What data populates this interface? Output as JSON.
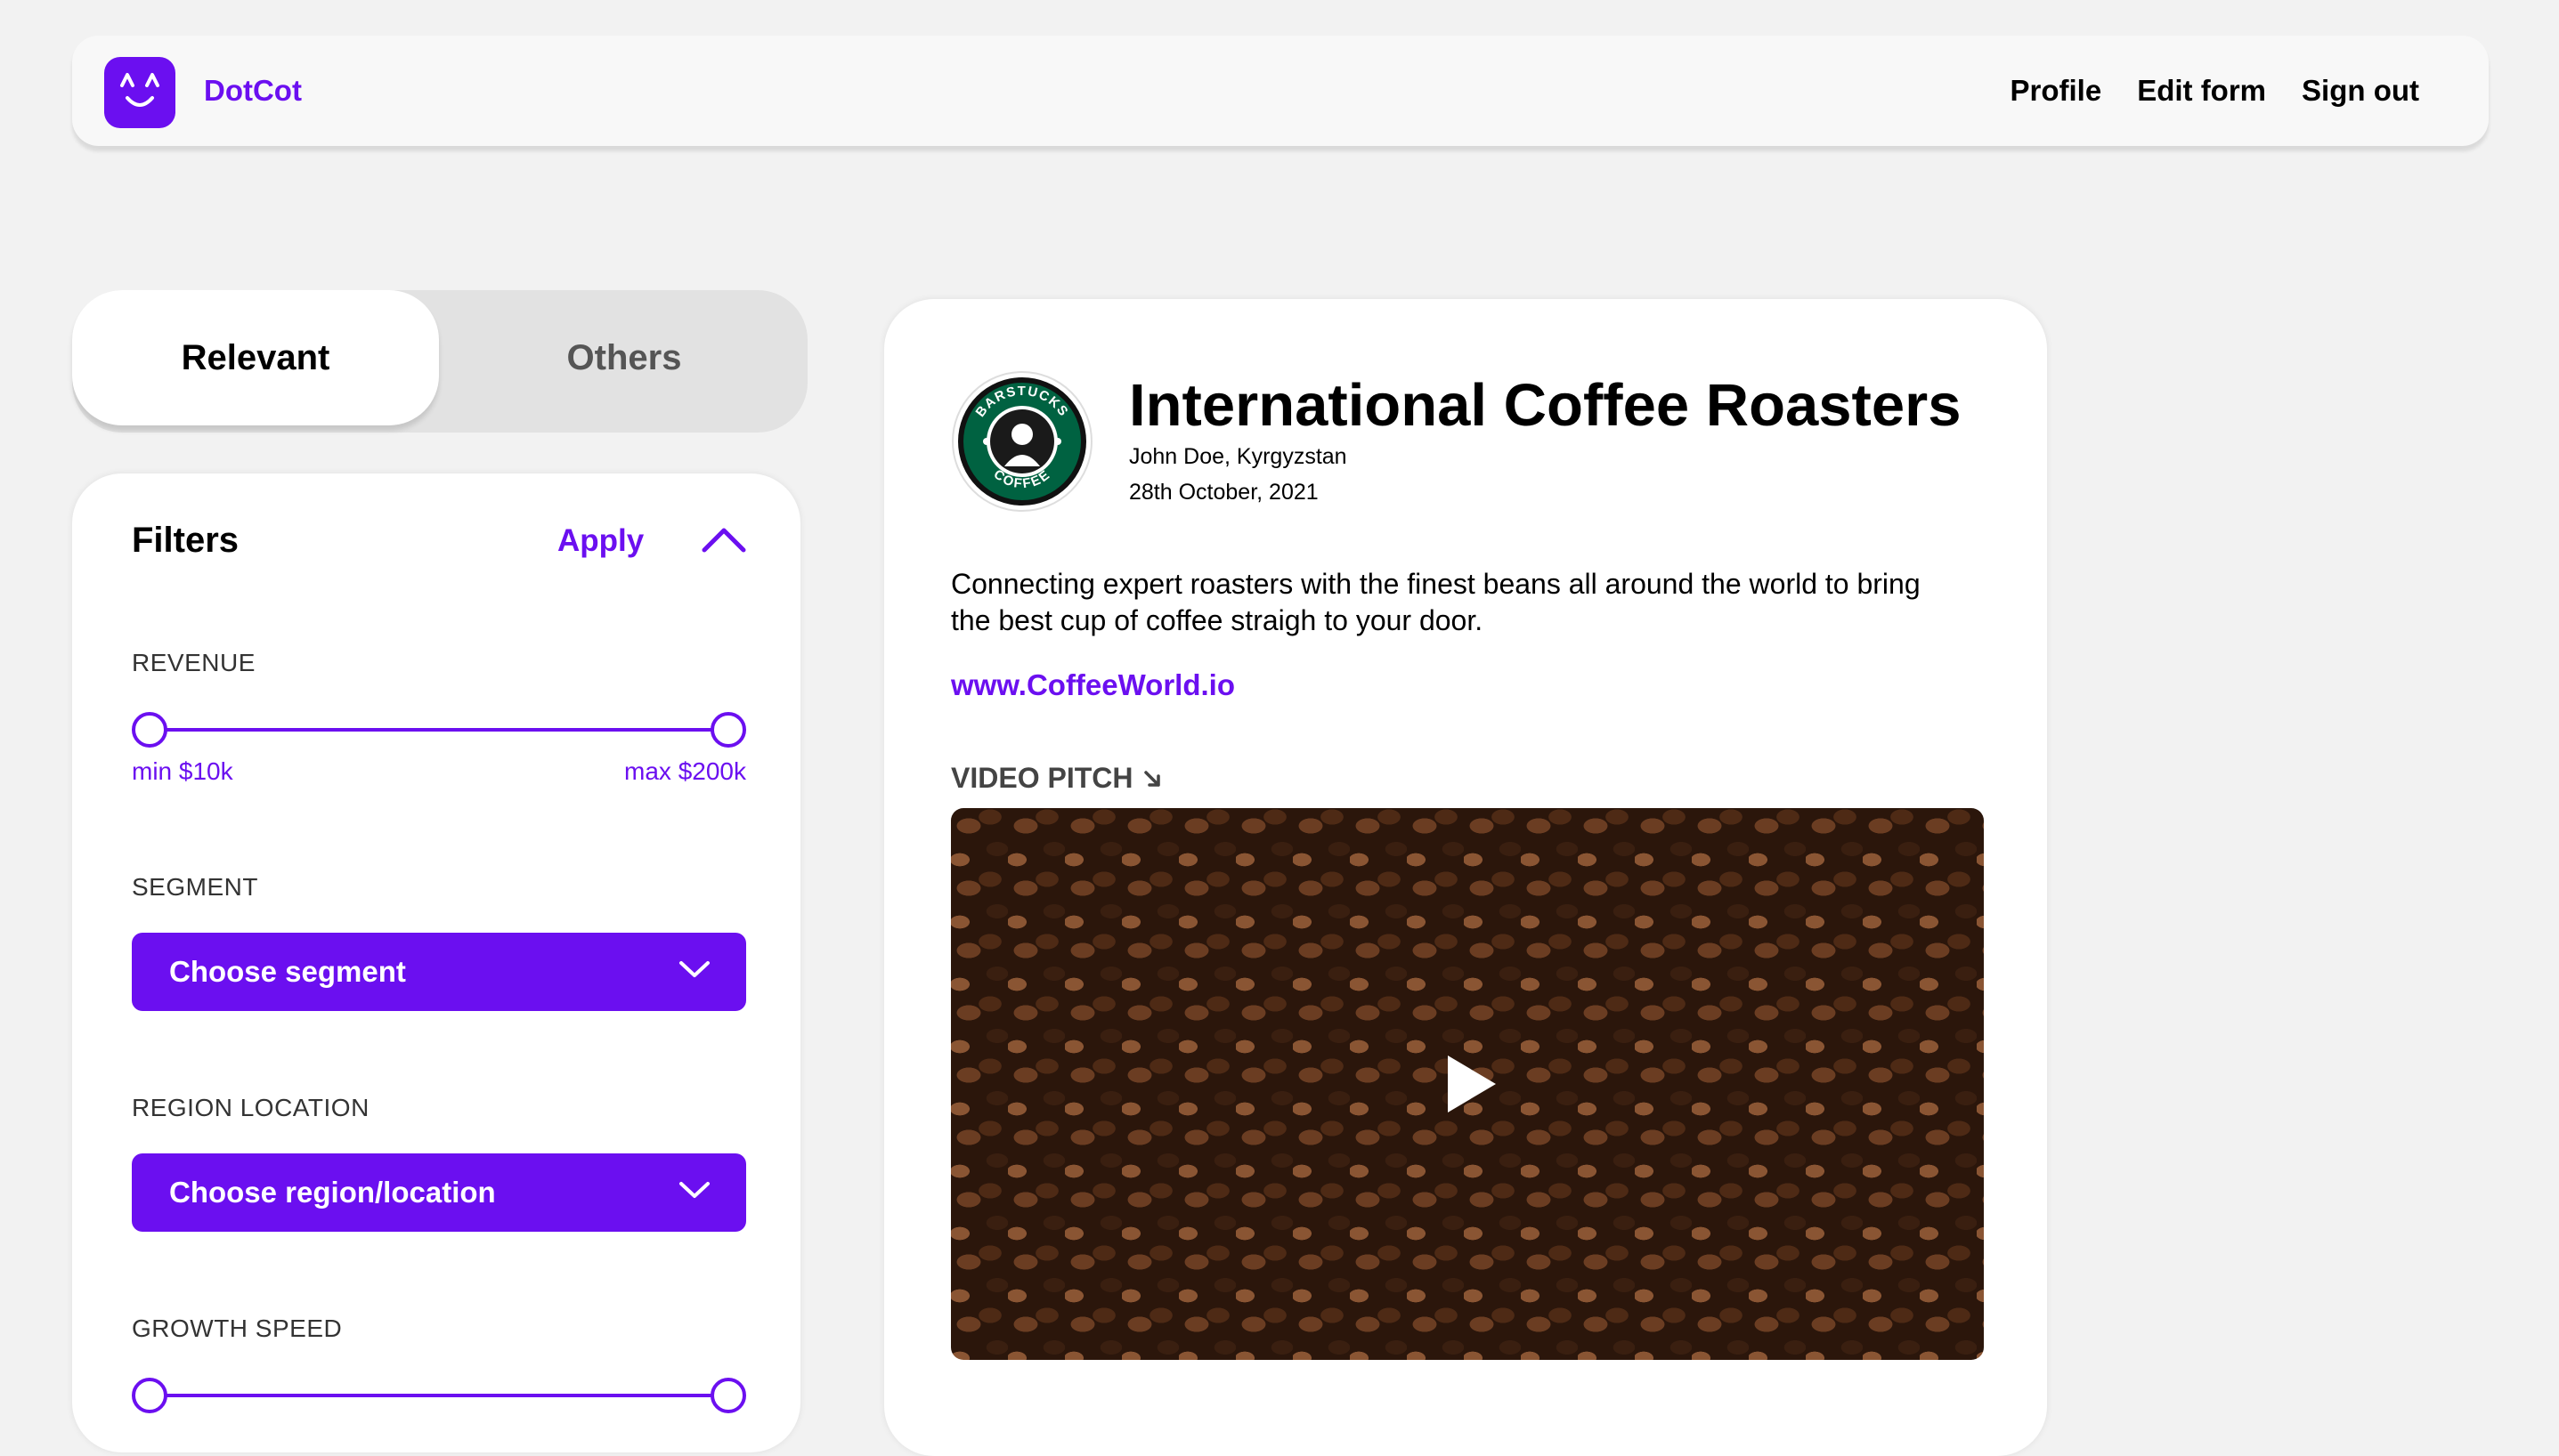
{
  "nav": {
    "brand": "DotCot",
    "links": [
      "Profile",
      "Edit form",
      "Sign out"
    ]
  },
  "tabs": [
    {
      "label": "Relevant",
      "active": true
    },
    {
      "label": "Others",
      "active": false
    }
  ],
  "filters": {
    "title": "Filters",
    "apply_label": "Apply",
    "revenue": {
      "label": "REVENUE",
      "min_label": "min $10k",
      "max_label": "max $200k"
    },
    "segment": {
      "label": "SEGMENT",
      "value": "Choose segment"
    },
    "region": {
      "label": "REGION LOCATION",
      "value": "Choose region/location"
    },
    "growth": {
      "label": "GROWTH SPEED"
    }
  },
  "company": {
    "name": "International Coffee Roasters",
    "owner_location": "John Doe, Kyrgyzstan",
    "date": "28th October, 2021",
    "description": "Connecting expert roasters with the finest beans all around the world to bring the best cup of coffee straigh to your door.",
    "website": "www.CoffeeWorld.io",
    "logo_text": "BARSTUCKS COFFEE",
    "video_label": "VIDEO PITCH"
  },
  "colors": {
    "accent": "#6b0ff0",
    "background": "#f2f2f2",
    "logo_green": "#006241"
  }
}
